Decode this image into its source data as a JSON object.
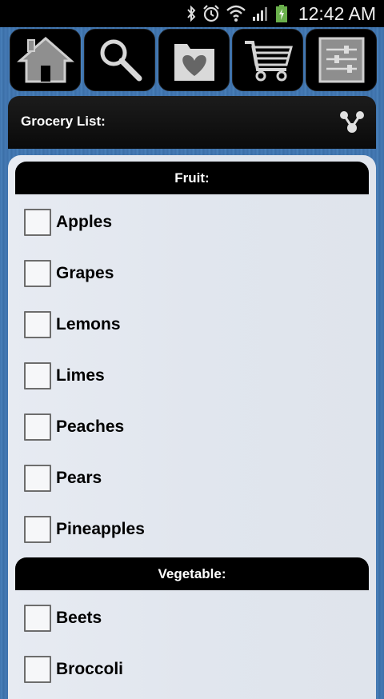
{
  "status_bar": {
    "time": "12:42 AM",
    "icons": [
      "bluetooth-icon",
      "alarm-icon",
      "wifi-icon",
      "signal-icon",
      "battery-charging-icon"
    ]
  },
  "toolbar": {
    "buttons": [
      {
        "name": "home",
        "icon": "home-icon"
      },
      {
        "name": "search",
        "icon": "search-icon"
      },
      {
        "name": "favorites",
        "icon": "heart-folder-icon"
      },
      {
        "name": "cart",
        "icon": "cart-icon"
      },
      {
        "name": "settings",
        "icon": "sliders-icon"
      }
    ]
  },
  "header": {
    "title": "Grocery List:",
    "action_icon": "share-icon"
  },
  "sections": [
    {
      "title": "Fruit:",
      "items": [
        "Apples",
        "Grapes",
        "Lemons",
        "Limes",
        "Peaches",
        "Pears",
        "Pineapples"
      ]
    },
    {
      "title": "Vegetable:",
      "items": [
        "Beets",
        "Broccoli"
      ]
    }
  ],
  "colors": {
    "background": "#4579b3",
    "panel": "#e3e8ef",
    "header": "#000000"
  }
}
